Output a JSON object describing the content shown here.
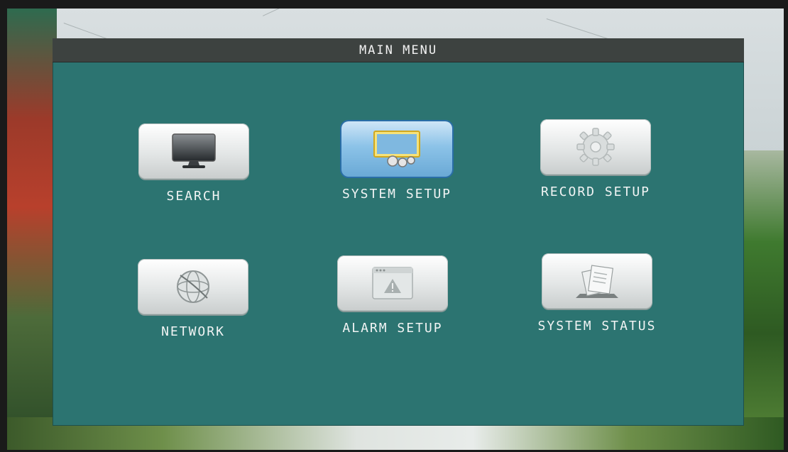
{
  "menu": {
    "title": "MAIN MENU",
    "items": [
      {
        "label": "SEARCH",
        "icon": "monitor-icon"
      },
      {
        "label": "SYSTEM SETUP",
        "icon": "system-setup-icon"
      },
      {
        "label": "RECORD SETUP",
        "icon": "gear-icon"
      },
      {
        "label": "NETWORK",
        "icon": "globe-icon"
      },
      {
        "label": "ALARM SETUP",
        "icon": "alarm-icon"
      },
      {
        "label": "SYSTEM STATUS",
        "icon": "documents-icon"
      }
    ],
    "selected": "SYSTEM SETUP"
  },
  "colors": {
    "panel": "#2c7471",
    "title_bar": "#3d4240",
    "label_text": "#f1f4f4",
    "selected_highlight": "#2a6ea8"
  }
}
